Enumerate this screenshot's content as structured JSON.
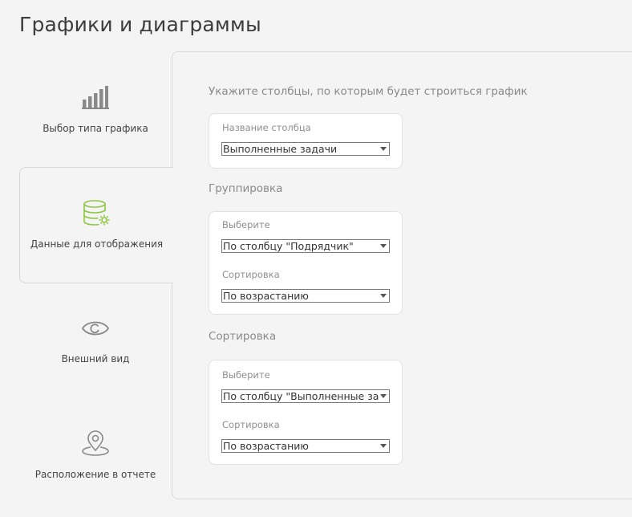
{
  "page": {
    "title": "Графики и диаграммы"
  },
  "steps": [
    {
      "label": "Выбор типа графика",
      "icon": "bar-chart-icon"
    },
    {
      "label": "Данные для отображения",
      "icon": "database-settings-icon",
      "active": true,
      "accent": "#8dc63f"
    },
    {
      "label": "Внешний вид",
      "icon": "eye-icon"
    },
    {
      "label": "Расположение в отчете",
      "icon": "map-pin-icon"
    }
  ],
  "columns": {
    "heading": "Укажите столбцы, по которым будет строиться график",
    "field_label": "Название столбца",
    "field_value": "Выполненные задачи"
  },
  "grouping": {
    "heading": "Группировка",
    "choose_label": "Выберите",
    "choose_value": "По столбцу \"Подрядчик\"",
    "sort_label": "Сортировка",
    "sort_value": "По возрастанию"
  },
  "sorting": {
    "heading": "Сортировка",
    "choose_label": "Выберите",
    "choose_value": "По столбцу \"Выполненные задачи\"",
    "sort_label": "Сортировка",
    "sort_value": "По возрастанию"
  }
}
